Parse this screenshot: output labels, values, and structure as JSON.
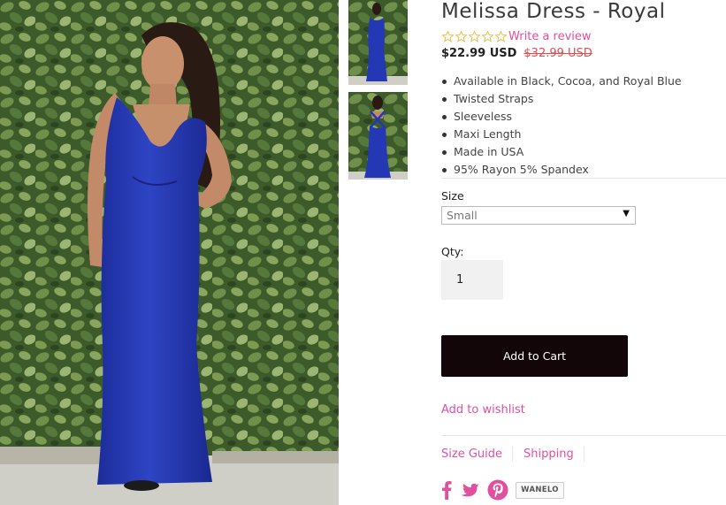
{
  "product": {
    "title": "Melissa Dress - Royal",
    "price": "$22.99 USD",
    "old_price": "$32.99 USD",
    "rating": {
      "stars": 5,
      "filled": 0,
      "review_link": "Write a review"
    },
    "features": [
      "Available in Black, Cocoa, and Royal Blue",
      "Twisted Straps",
      "Sleeveless",
      "Maxi Length",
      "Made in USA",
      "95% Rayon 5% Spandex"
    ]
  },
  "options": {
    "size_label": "Size",
    "size_value": "Small",
    "qty_label": "Qty:",
    "qty_value": "1"
  },
  "actions": {
    "add_to_cart": "Add to Cart",
    "wishlist": "Add to wishlist"
  },
  "links": [
    "Size Guide",
    "Shipping"
  ],
  "social": {
    "icons": [
      "facebook-icon",
      "twitter-icon",
      "pinterest-icon"
    ],
    "wanelo_label": "WANELO"
  },
  "colors": {
    "accent": "#e0509e",
    "button": "#120608",
    "strike": "#e05050",
    "dress": "#2437b5",
    "foliage": "#3f5a2c"
  }
}
